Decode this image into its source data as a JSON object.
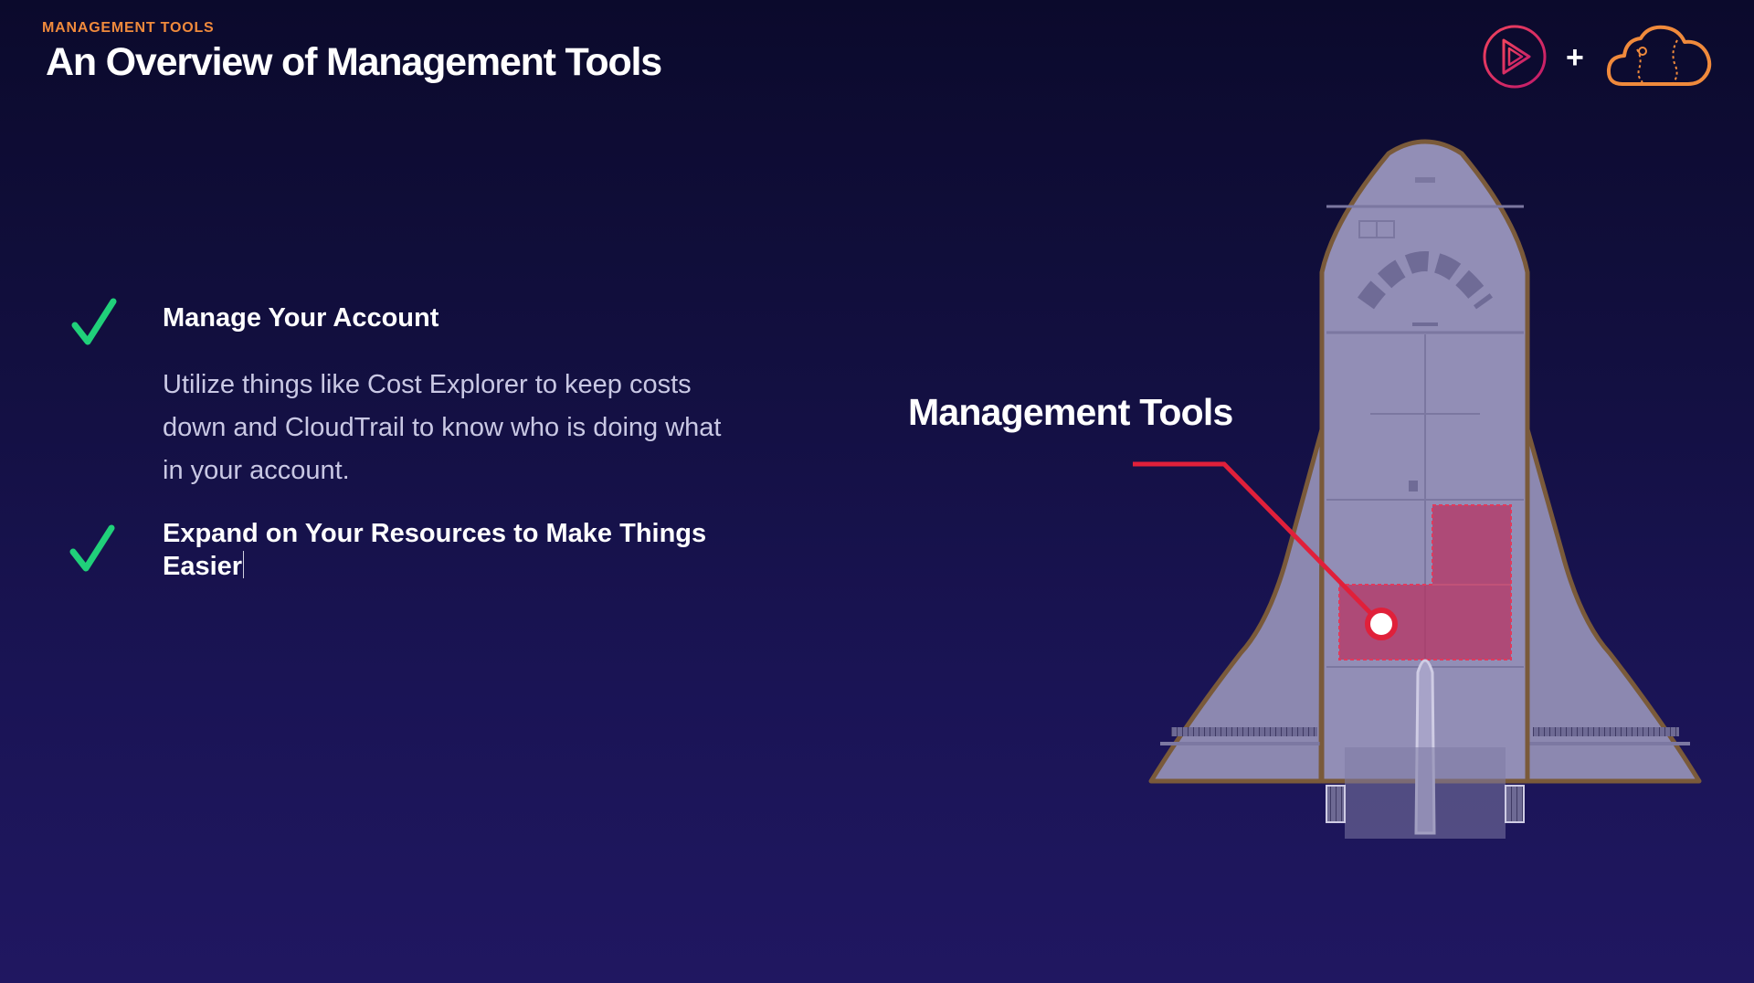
{
  "header": {
    "eyebrow": "MANAGEMENT TOOLS",
    "title": "An Overview of Management Tools"
  },
  "branding": {
    "plus": "+",
    "left_logo_icon": "play-circle-icon",
    "right_logo_icon": "cloud-icon",
    "colors": {
      "play": "#e0245e",
      "cloud": "#f08a3c"
    }
  },
  "checklist": [
    {
      "title": "Manage Your Account",
      "description": "Utilize things like Cost Explorer to keep costs down and CloudTrail to know who is doing what in your account."
    },
    {
      "title": "Expand on Your Resources to Make Things Easier"
    }
  ],
  "diagram": {
    "label": "Management Tools",
    "accent": "#e0203a",
    "check_color": "#20d07a"
  }
}
